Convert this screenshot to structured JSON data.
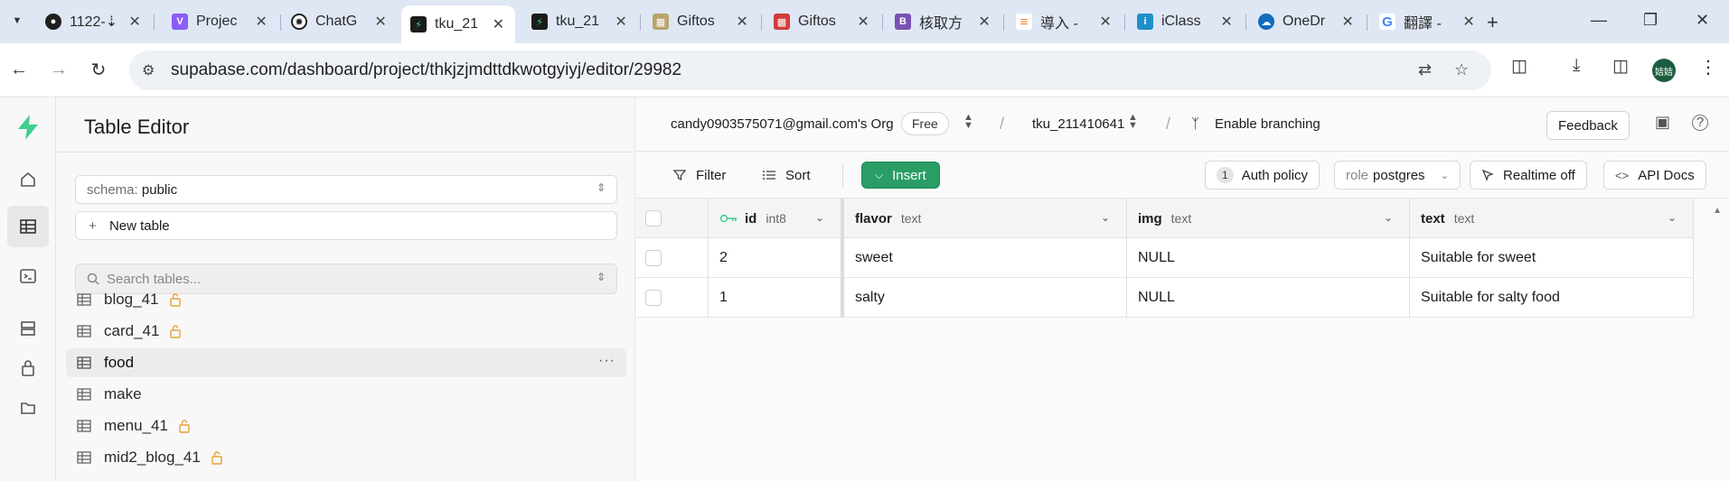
{
  "browser": {
    "tabs": [
      {
        "title": "1122-⇣",
        "icon": "github-icon",
        "color": "#1f1f1f"
      },
      {
        "title": "Projec",
        "icon": "vite-icon",
        "color": "#8b5cf6"
      },
      {
        "title": "ChatG",
        "icon": "chatgpt-icon",
        "color": "#222222"
      },
      {
        "title": "tku_21",
        "icon": "supabase-icon",
        "color": "#1c1c1c",
        "active": true
      },
      {
        "title": "tku_21",
        "icon": "supabase-icon",
        "color": "#1c1c1c"
      },
      {
        "title": "Giftos",
        "icon": "page-icon",
        "color": "#b9a46a"
      },
      {
        "title": "Giftos",
        "icon": "gift-icon",
        "color": "#d43a3a"
      },
      {
        "title": "核取方",
        "icon": "bootstrap-icon",
        "color": "#7952b3"
      },
      {
        "title": "導入 -",
        "icon": "stackoverflow-icon",
        "color": "#f48024"
      },
      {
        "title": "iClass",
        "icon": "iclass-icon",
        "color": "#1e90c8"
      },
      {
        "title": "OneDr",
        "icon": "onedrive-icon",
        "color": "#0f6cbd"
      },
      {
        "title": "翻譯 -",
        "icon": "google-icon",
        "color": "#4285f4"
      }
    ],
    "url": "supabase.com/dashboard/project/thkjzjmdttdkwotgyiyj/editor/29982",
    "avatar_text": "姞姞"
  },
  "sidebar": {
    "title": "Table Editor",
    "schema_label": "schema:",
    "schema_value": "public",
    "new_table_label": "New table",
    "search_placeholder": "Search tables...",
    "tables": [
      {
        "name": "blog_41",
        "locked": true
      },
      {
        "name": "card_41",
        "locked": true
      },
      {
        "name": "food",
        "locked": false,
        "active": true
      },
      {
        "name": "make",
        "locked": false
      },
      {
        "name": "menu_41",
        "locked": true
      },
      {
        "name": "mid2_blog_41",
        "locked": true
      }
    ]
  },
  "header": {
    "org": "candy0903575071@gmail.com's Org",
    "plan": "Free",
    "project": "tku_211410641",
    "branching": "Enable branching",
    "feedback": "Feedback"
  },
  "toolbar": {
    "filter": "Filter",
    "sort": "Sort",
    "insert": "Insert",
    "auth_count": "1",
    "auth_policy": "Auth policy",
    "role_label": "role",
    "role_value": "postgres",
    "realtime": "Realtime off",
    "api_docs": "API Docs"
  },
  "grid": {
    "columns": [
      {
        "name": "id",
        "type": "int8",
        "primary_key": true
      },
      {
        "name": "flavor",
        "type": "text"
      },
      {
        "name": "img",
        "type": "text"
      },
      {
        "name": "text",
        "type": "text"
      }
    ],
    "rows": [
      {
        "id": "2",
        "flavor": "sweet",
        "img": "NULL",
        "text": "Suitable for sweet"
      },
      {
        "id": "1",
        "flavor": "salty",
        "img": "NULL",
        "text": "Suitable for salty food"
      }
    ]
  },
  "colors": {
    "accent": "#2a9d67",
    "supabase_green": "#3ecf8e",
    "lock": "#e8a23a"
  }
}
